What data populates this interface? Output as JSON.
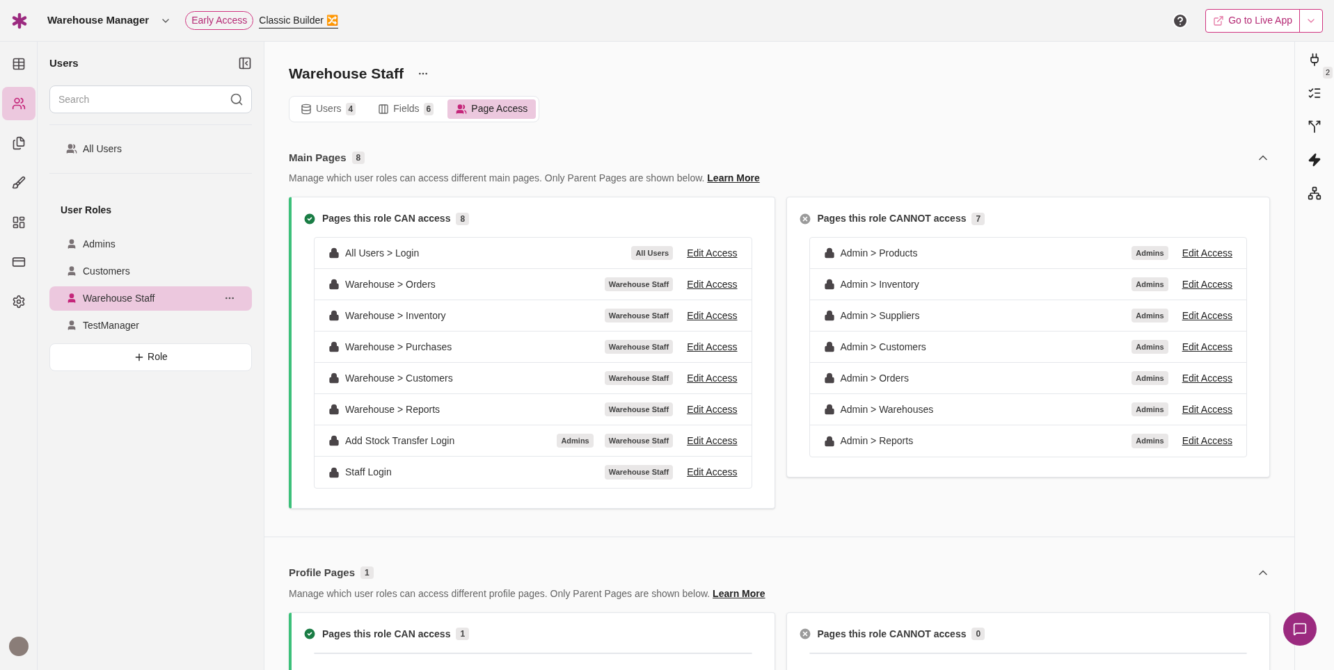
{
  "topbar": {
    "app_name": "Warehouse Manager",
    "badge": "Early Access",
    "builder_link": "Classic Builder",
    "builder_emoji": "🔀",
    "live_button": "Go to Live App"
  },
  "rail": [
    {
      "selected": false
    },
    {
      "selected": true
    },
    {
      "selected": false
    },
    {
      "selected": false
    },
    {
      "selected": false
    },
    {
      "selected": false
    },
    {
      "selected": false
    }
  ],
  "sidebar": {
    "title": "Users",
    "search": {
      "placeholder": "Search"
    },
    "all_users": "All Users",
    "roles_heading": "User Roles",
    "roles": [
      {
        "label": "Admins",
        "selected": false
      },
      {
        "label": "Customers",
        "selected": false
      },
      {
        "label": "Warehouse Staff",
        "selected": true
      },
      {
        "label": "TestManager",
        "selected": false
      }
    ],
    "add_button": "Role"
  },
  "page": {
    "title": "Warehouse Staff",
    "tabs": [
      {
        "label": "Users",
        "count": "4",
        "selected": false
      },
      {
        "label": "Fields",
        "count": "6",
        "selected": false
      },
      {
        "label": "Page Access",
        "selected": true
      }
    ],
    "sections": [
      {
        "title": "Main Pages",
        "count": "8",
        "expanded": true,
        "description": "Manage which user roles can access different main pages. Only Parent Pages are shown below.",
        "link": "Learn More",
        "can": {
          "title": "Pages this role CAN access",
          "count": "8",
          "rows": [
            {
              "page": "All Users > Login",
              "roles": [
                "All Users"
              ],
              "action": "Edit Access"
            },
            {
              "page": "Warehouse > Orders",
              "roles": [
                "Warehouse Staff"
              ],
              "action": "Edit Access"
            },
            {
              "page": "Warehouse > Inventory",
              "roles": [
                "Warehouse Staff"
              ],
              "action": "Edit Access"
            },
            {
              "page": "Warehouse > Purchases",
              "roles": [
                "Warehouse Staff"
              ],
              "action": "Edit Access"
            },
            {
              "page": "Warehouse > Customers",
              "roles": [
                "Warehouse Staff"
              ],
              "action": "Edit Access"
            },
            {
              "page": "Warehouse > Reports",
              "roles": [
                "Warehouse Staff"
              ],
              "action": "Edit Access"
            },
            {
              "page": "Add Stock Transfer Login",
              "roles": [
                "Admins",
                "Warehouse Staff"
              ],
              "action": "Edit Access"
            },
            {
              "page": "Staff Login",
              "roles": [
                "Warehouse Staff"
              ],
              "action": "Edit Access"
            }
          ]
        },
        "cannot": {
          "title": "Pages this role CANNOT access",
          "count": "7",
          "rows": [
            {
              "page": "Admin > Products",
              "roles": [
                "Admins"
              ],
              "action": "Edit Access"
            },
            {
              "page": "Admin > Inventory",
              "roles": [
                "Admins"
              ],
              "action": "Edit Access"
            },
            {
              "page": "Admin > Suppliers",
              "roles": [
                "Admins"
              ],
              "action": "Edit Access"
            },
            {
              "page": "Admin > Customers",
              "roles": [
                "Admins"
              ],
              "action": "Edit Access"
            },
            {
              "page": "Admin > Orders",
              "roles": [
                "Admins"
              ],
              "action": "Edit Access"
            },
            {
              "page": "Admin > Warehouses",
              "roles": [
                "Admins"
              ],
              "action": "Edit Access"
            },
            {
              "page": "Admin > Reports",
              "roles": [
                "Admins"
              ],
              "action": "Edit Access"
            }
          ]
        }
      },
      {
        "title": "Profile Pages",
        "count": "1",
        "expanded": true,
        "description": "Manage which user roles can access different profile pages. Only Parent Pages are shown below.",
        "link": "Learn More",
        "can": {
          "title": "Pages this role CAN access",
          "count": "1"
        },
        "cannot": {
          "title": "Pages this role CANNOT access",
          "count": "0"
        }
      }
    ]
  },
  "right_rail": {
    "badge": "2"
  }
}
